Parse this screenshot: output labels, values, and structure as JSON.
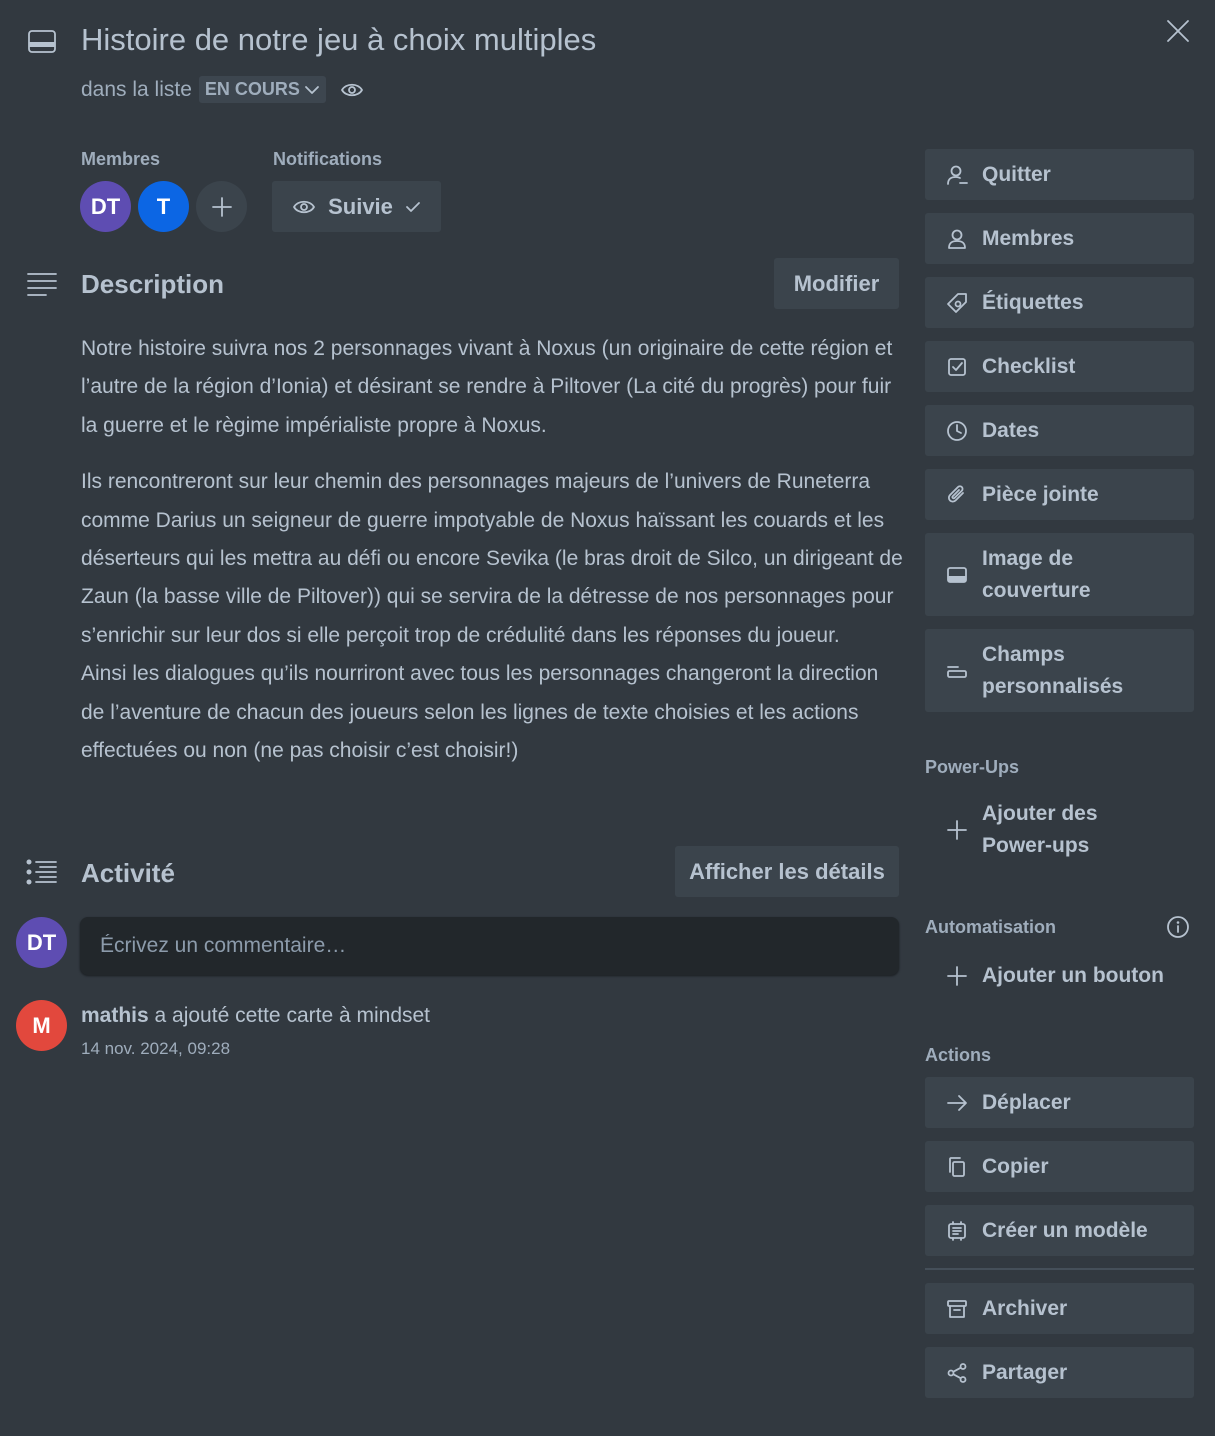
{
  "card": {
    "title": "Histoire de notre jeu à choix multiples",
    "in_list_prefix": "dans la liste",
    "list_name": "EN COURS"
  },
  "members": {
    "label": "Membres",
    "avatars": [
      {
        "initials": "DT",
        "color": "#5e4db2"
      },
      {
        "initials": "T",
        "color": "#0c66e4"
      }
    ]
  },
  "notifications": {
    "label": "Notifications",
    "watch_label": "Suivie"
  },
  "description": {
    "heading": "Description",
    "edit_label": "Modifier",
    "paragraphs": [
      "Notre histoire suivra nos 2 personnages vivant à Noxus (un originaire de cette région et l’autre de la région d’Ionia) et désirant se rendre à Piltover (La cité du progrès) pour fuir la guerre et le règime impérialiste propre à Noxus.",
      "Ils rencontreront sur leur chemin des personnages majeurs de l’univers de Runeterra comme Darius un seigneur de guerre impotyable de Noxus haïssant les couards et les déserteurs qui les mettra au défi ou encore Sevika (le bras droit de Silco, un dirigeant de Zaun (la basse ville de Piltover)) qui se servira de la détresse de nos personnages pour s’enrichir sur leur dos si elle perçoit trop de crédulité dans les réponses du joueur.",
      "Ainsi les dialogues qu’ils nourriront avec tous les personnages changeront la direction de l’aventure de chacun des joueurs selon les lignes de texte choisies et les actions effectuées ou non (ne pas choisir c’est choisir!)"
    ]
  },
  "activity": {
    "heading": "Activité",
    "details_label": "Afficher les détails",
    "comment_avatar": "DT",
    "comment_placeholder": "Écrivez un commentaire…",
    "entries": [
      {
        "avatar": "M",
        "avatar_color": "#e2483d",
        "user": "mathis",
        "action": " a ajouté cette carte à mindset",
        "time": "14 nov. 2024, 09:28"
      }
    ]
  },
  "sidebar": {
    "buttons": [
      {
        "label": "Quitter",
        "icon": "leave-icon"
      },
      {
        "label": "Membres",
        "icon": "member-icon"
      },
      {
        "label": "Étiquettes",
        "icon": "label-icon"
      },
      {
        "label": "Checklist",
        "icon": "checklist-icon"
      },
      {
        "label": "Dates",
        "icon": "clock-icon"
      },
      {
        "label": "Pièce jointe",
        "icon": "attachment-icon"
      },
      {
        "label": "Image de couverture",
        "icon": "cover-icon"
      },
      {
        "label": "Champs personnalisés",
        "icon": "custom-fields-icon"
      }
    ],
    "powerups_label": "Power-Ups",
    "add_powerups": "Ajouter des Power-ups",
    "automation_label": "Automatisation",
    "add_button": "Ajouter un bouton",
    "actions_label": "Actions",
    "actions": [
      {
        "label": "Déplacer",
        "icon": "arrow-right-icon"
      },
      {
        "label": "Copier",
        "icon": "copy-icon"
      },
      {
        "label": "Créer un modèle",
        "icon": "template-icon"
      },
      {
        "label": "Archiver",
        "icon": "archive-icon"
      },
      {
        "label": "Partager",
        "icon": "share-icon"
      }
    ]
  },
  "colors": {
    "background": "#323940",
    "button": "#3b444c",
    "text": "#b6c2cf",
    "input": "#22272b"
  }
}
